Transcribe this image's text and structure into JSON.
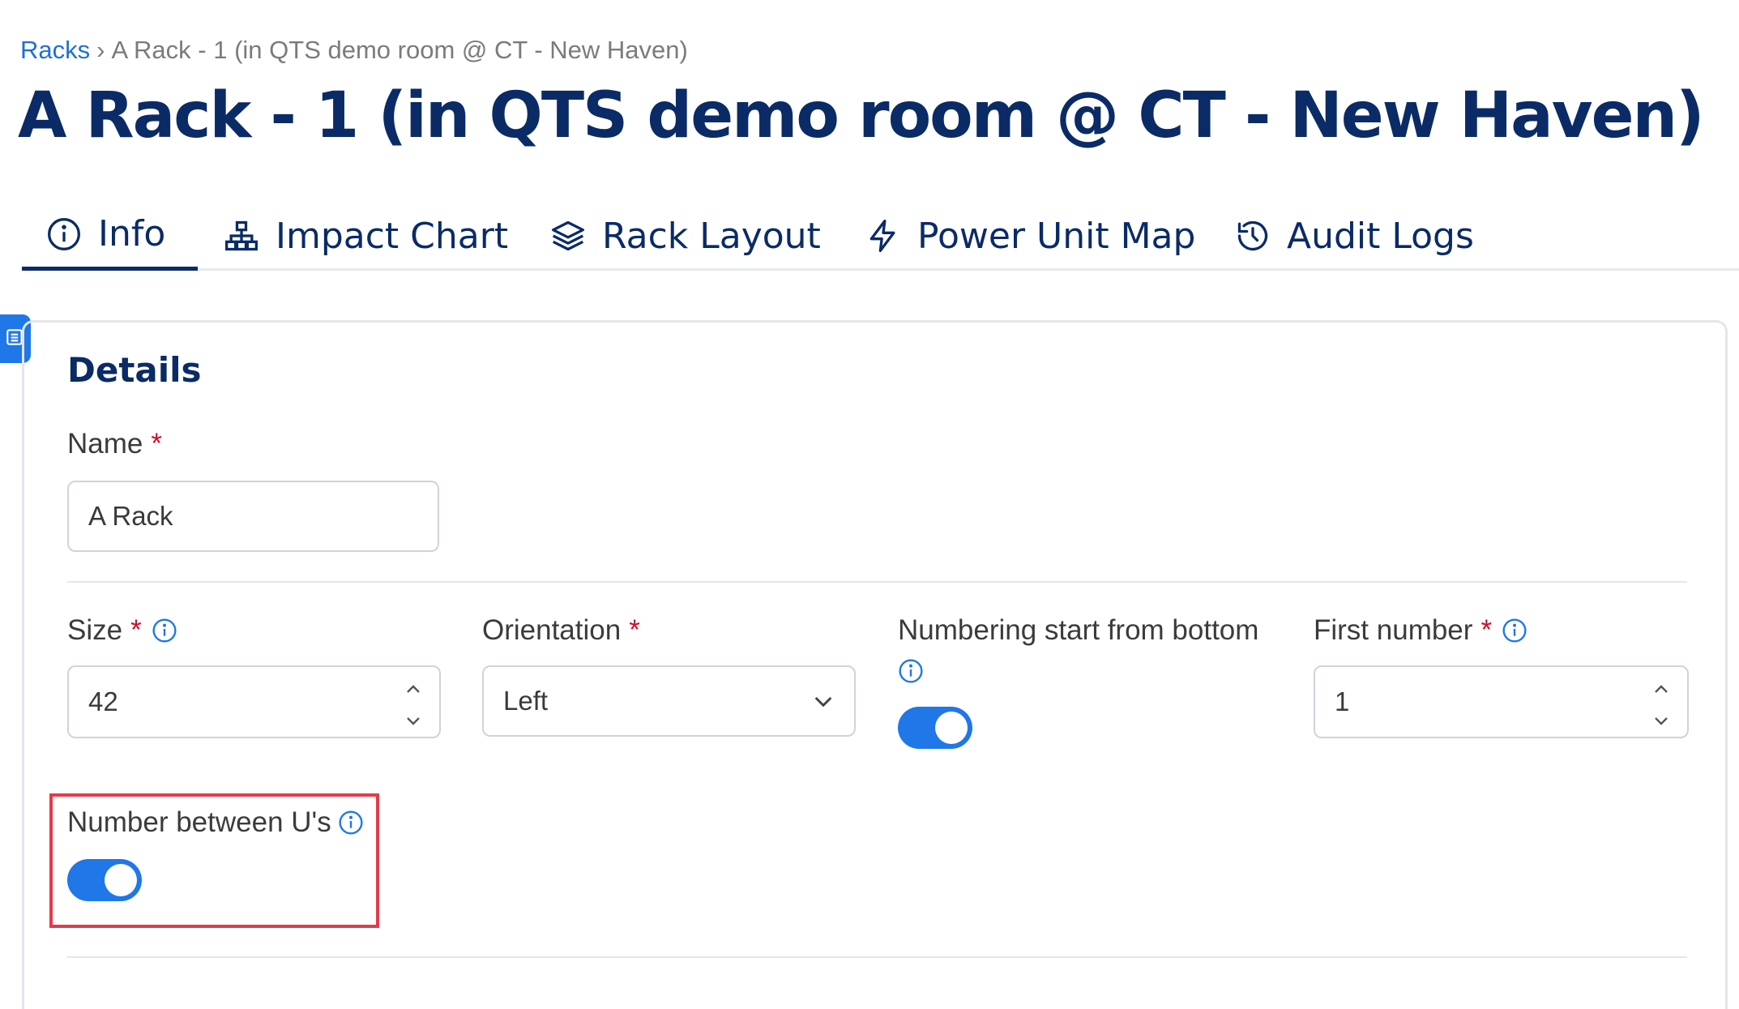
{
  "breadcrumb": {
    "parent": "Racks",
    "separator": "›",
    "current": "A Rack - 1 (in QTS demo room @ CT - New Haven)"
  },
  "page_title": "A Rack - 1 (in QTS demo room @ CT - New Haven)",
  "tabs": [
    {
      "label": "Info",
      "icon": "info-circle-icon",
      "active": true
    },
    {
      "label": "Impact Chart",
      "icon": "hierarchy-icon",
      "active": false
    },
    {
      "label": "Rack Layout",
      "icon": "layers-icon",
      "active": false
    },
    {
      "label": "Power Unit Map",
      "icon": "lightning-icon",
      "active": false
    },
    {
      "label": "Audit Logs",
      "icon": "history-icon",
      "active": false
    }
  ],
  "details": {
    "title": "Details",
    "name_field": {
      "label": "Name",
      "required_mark": "*",
      "value": "A Rack"
    },
    "size_field": {
      "label": "Size",
      "required_mark": "*",
      "value": "42"
    },
    "orientation_field": {
      "label": "Orientation",
      "required_mark": "*",
      "value": "Left"
    },
    "numbering_field": {
      "label": "Numbering start from bottom",
      "enabled": true
    },
    "first_number_field": {
      "label": "First number",
      "required_mark": "*",
      "value": "1"
    },
    "number_between_field": {
      "label": "Number between U's",
      "enabled": true
    }
  },
  "colors": {
    "title": "#0a2b66",
    "link": "#1f6fd6",
    "accent": "#1f77e8",
    "required": "#c8102e",
    "highlight": "#e23b4a"
  }
}
